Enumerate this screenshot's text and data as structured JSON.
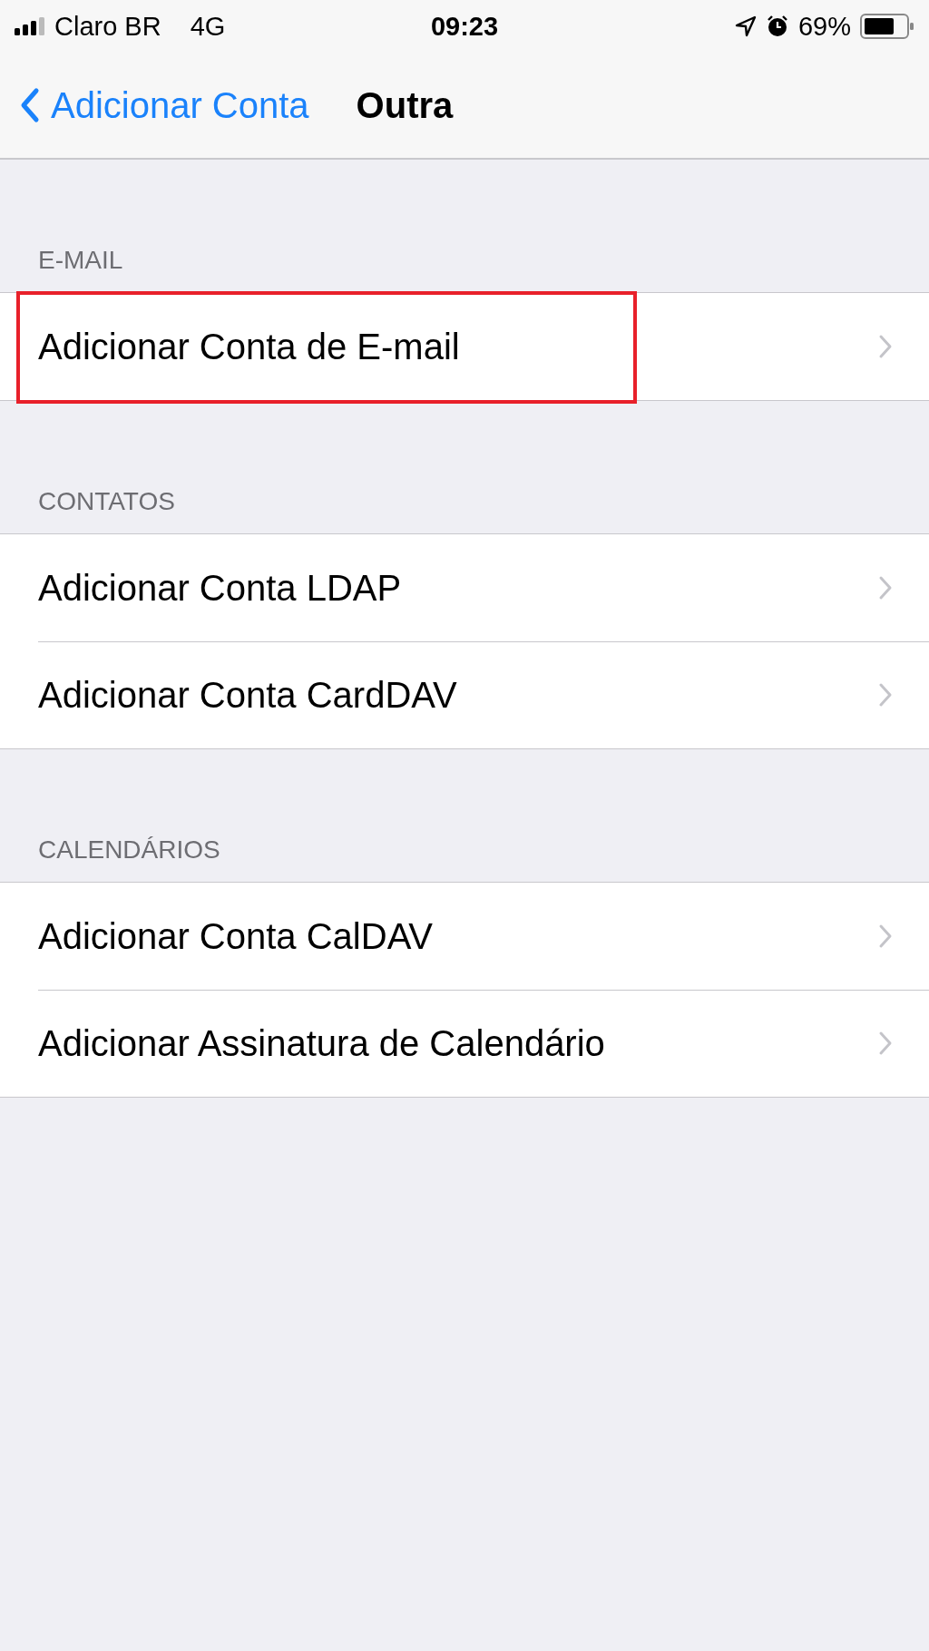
{
  "status_bar": {
    "carrier": "Claro BR",
    "network": "4G",
    "time": "09:23",
    "battery": "69%"
  },
  "nav_bar": {
    "back": "Adicionar Conta",
    "title": "Outra"
  },
  "sections": [
    {
      "header": "E-MAIL",
      "items": [
        {
          "label": "Adicionar Conta de E-mail",
          "highlighted": true
        }
      ]
    },
    {
      "header": "CONTATOS",
      "items": [
        {
          "label": "Adicionar Conta LDAP",
          "highlighted": false
        },
        {
          "label": "Adicionar Conta CardDAV",
          "highlighted": false
        }
      ]
    },
    {
      "header": "CALENDÁRIOS",
      "items": [
        {
          "label": "Adicionar Conta CalDAV",
          "highlighted": false
        },
        {
          "label": "Adicionar Assinatura de Calendário",
          "highlighted": false
        }
      ]
    }
  ]
}
